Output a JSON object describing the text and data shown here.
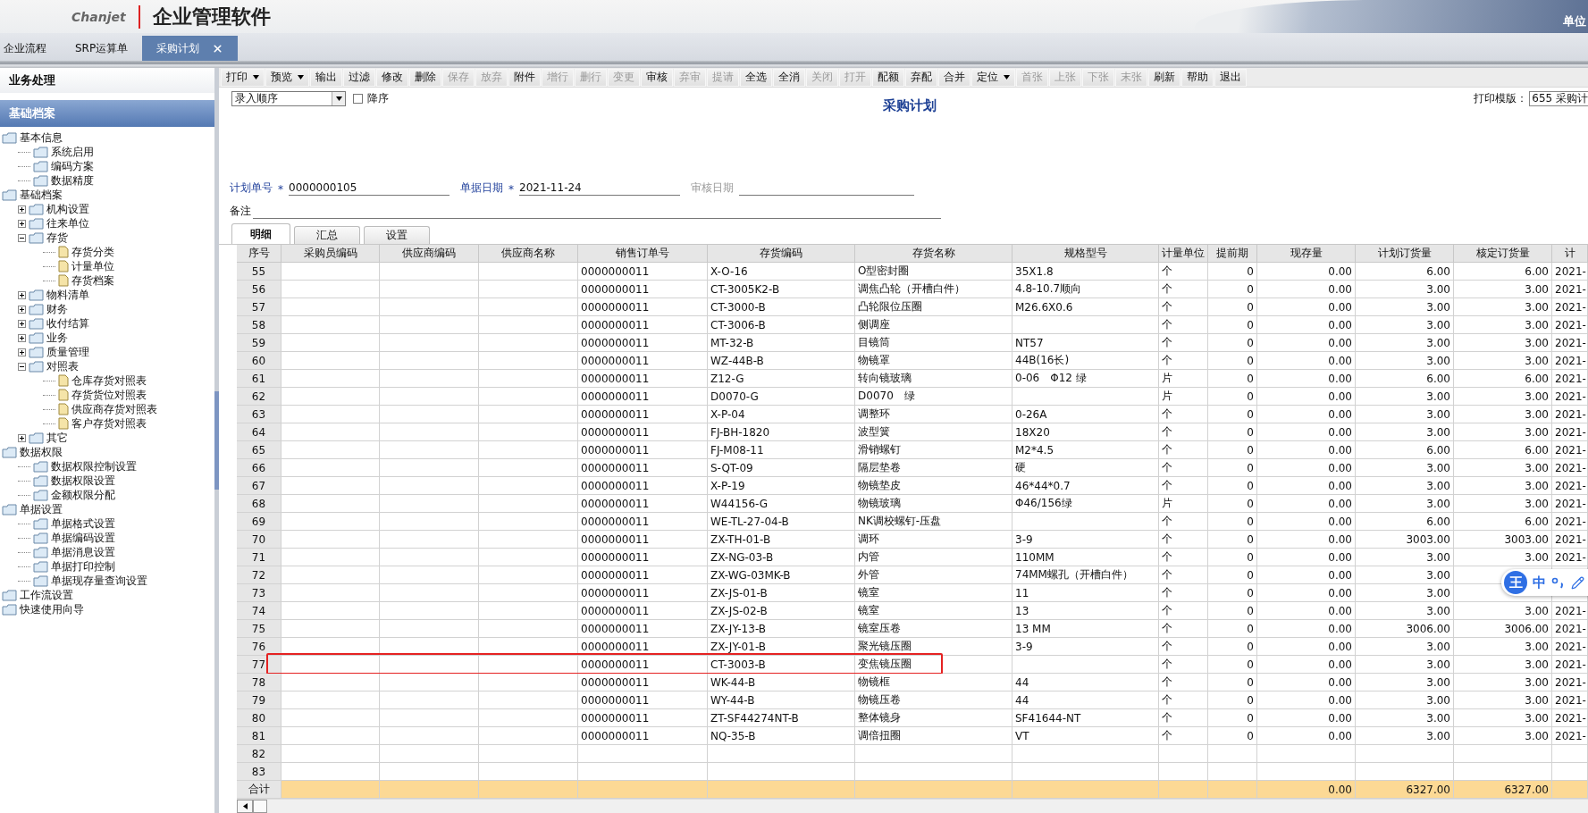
{
  "header": {
    "brand": "Chanjet",
    "product": "企业管理软件",
    "user_label": "单位"
  },
  "doc_tabs": [
    {
      "label": "企业流程",
      "selected": false,
      "closable": false
    },
    {
      "label": "SRP运算单",
      "selected": false,
      "closable": false
    },
    {
      "label": "采购计划",
      "selected": true,
      "closable": true
    }
  ],
  "sidebar": {
    "sections": [
      {
        "label": "业务处理",
        "selected": false
      },
      {
        "label": "基础档案",
        "selected": true
      }
    ],
    "tree": [
      {
        "label": "基本信息",
        "kind": "folder",
        "children": [
          {
            "label": "系统启用",
            "kind": "folder"
          },
          {
            "label": "编码方案",
            "kind": "folder"
          },
          {
            "label": "数据精度",
            "kind": "folder"
          }
        ]
      },
      {
        "label": "基础档案",
        "kind": "folder",
        "children": [
          {
            "label": "机构设置",
            "kind": "folder",
            "expanded": false
          },
          {
            "label": "往来单位",
            "kind": "folder",
            "expanded": false
          },
          {
            "label": "存货",
            "kind": "folder",
            "expanded": true,
            "children": [
              {
                "label": "存货分类",
                "kind": "document"
              },
              {
                "label": "计量单位",
                "kind": "document"
              },
              {
                "label": "存货档案",
                "kind": "document"
              }
            ]
          },
          {
            "label": "物料清单",
            "kind": "folder",
            "expanded": false
          },
          {
            "label": "财务",
            "kind": "folder",
            "expanded": false
          },
          {
            "label": "收付结算",
            "kind": "folder",
            "expanded": false
          },
          {
            "label": "业务",
            "kind": "folder",
            "expanded": false
          },
          {
            "label": "质量管理",
            "kind": "folder",
            "expanded": false
          },
          {
            "label": "对照表",
            "kind": "folder",
            "expanded": true,
            "children": [
              {
                "label": "仓库存货对照表",
                "kind": "document"
              },
              {
                "label": "存货货位对照表",
                "kind": "document"
              },
              {
                "label": "供应商存货对照表",
                "kind": "document"
              },
              {
                "label": "客户存货对照表",
                "kind": "document"
              }
            ]
          },
          {
            "label": "其它",
            "kind": "folder",
            "expanded": false
          }
        ]
      },
      {
        "label": "数据权限",
        "kind": "folder",
        "children": [
          {
            "label": "数据权限控制设置",
            "kind": "folder"
          },
          {
            "label": "数据权限设置",
            "kind": "folder"
          },
          {
            "label": "金额权限分配",
            "kind": "folder"
          }
        ]
      },
      {
        "label": "单据设置",
        "kind": "folder",
        "children": [
          {
            "label": "单据格式设置",
            "kind": "folder"
          },
          {
            "label": "单据编码设置",
            "kind": "folder"
          },
          {
            "label": "单据消息设置",
            "kind": "folder"
          },
          {
            "label": "单据打印控制",
            "kind": "folder"
          },
          {
            "label": "单据现存量查询设置",
            "kind": "folder"
          }
        ]
      },
      {
        "label": "工作流设置",
        "kind": "folder"
      },
      {
        "label": "快速使用向导",
        "kind": "folder"
      }
    ]
  },
  "toolbar": [
    {
      "label": "打印",
      "dropdown": true,
      "disabled": false
    },
    {
      "label": "预览",
      "dropdown": true,
      "disabled": false
    },
    {
      "label": "输出",
      "dropdown": false,
      "disabled": false
    },
    {
      "label": "过滤",
      "dropdown": false,
      "disabled": false
    },
    {
      "label": "修改",
      "dropdown": false,
      "disabled": false
    },
    {
      "label": "删除",
      "dropdown": false,
      "disabled": false
    },
    {
      "label": "保存",
      "dropdown": false,
      "disabled": true
    },
    {
      "label": "放弃",
      "dropdown": false,
      "disabled": true
    },
    {
      "label": "附件",
      "dropdown": false,
      "disabled": false
    },
    {
      "label": "增行",
      "dropdown": false,
      "disabled": true
    },
    {
      "label": "删行",
      "dropdown": false,
      "disabled": true
    },
    {
      "label": "变更",
      "dropdown": false,
      "disabled": true
    },
    {
      "label": "审核",
      "dropdown": false,
      "disabled": false
    },
    {
      "label": "弃审",
      "dropdown": false,
      "disabled": true
    },
    {
      "label": "提请",
      "dropdown": false,
      "disabled": true
    },
    {
      "label": "全选",
      "dropdown": false,
      "disabled": false
    },
    {
      "label": "全消",
      "dropdown": false,
      "disabled": false
    },
    {
      "label": "关闭",
      "dropdown": false,
      "disabled": true
    },
    {
      "label": "打开",
      "dropdown": false,
      "disabled": true
    },
    {
      "label": "配额",
      "dropdown": false,
      "disabled": false
    },
    {
      "label": "弃配",
      "dropdown": false,
      "disabled": false
    },
    {
      "label": "合并",
      "dropdown": false,
      "disabled": false
    },
    {
      "label": "定位",
      "dropdown": true,
      "disabled": false
    },
    {
      "label": "首张",
      "dropdown": false,
      "disabled": true
    },
    {
      "label": "上张",
      "dropdown": false,
      "disabled": true
    },
    {
      "label": "下张",
      "dropdown": false,
      "disabled": true
    },
    {
      "label": "末张",
      "dropdown": false,
      "disabled": true
    },
    {
      "label": "刷新",
      "dropdown": false,
      "disabled": false
    },
    {
      "label": "帮助",
      "dropdown": false,
      "disabled": false
    },
    {
      "label": "退出",
      "dropdown": false,
      "disabled": false
    }
  ],
  "form": {
    "sort": {
      "value": "录入顺序"
    },
    "descending": {
      "label": "降序",
      "checked": false
    },
    "title": "采购计划",
    "print_template": {
      "label": "打印模版：",
      "value": "655 采购计"
    },
    "fields": [
      {
        "label": "计划单号",
        "required_mark": "*",
        "value": "0000000105",
        "disabled": false
      },
      {
        "label": "单据日期",
        "required_mark": "*",
        "value": "2021-11-24",
        "disabled": false
      },
      {
        "label": "审核日期",
        "disabled": true
      }
    ],
    "note": {
      "label": "备注"
    }
  },
  "detail_tabs": [
    {
      "label": "明细",
      "selected": true
    },
    {
      "label": "汇总",
      "selected": false
    },
    {
      "label": "设置",
      "selected": false
    }
  ],
  "table": {
    "columns": [
      "序号",
      "采购员编码",
      "供应商编码",
      "供应商名称",
      "销售订单号",
      "存货编码",
      "存货名称",
      "规格型号",
      "计量单位",
      "提前期",
      "现存量",
      "计划订货量",
      "核定订货量",
      "计"
    ],
    "rows": [
      {
        "highlighted": false,
        "no": "55",
        "sales_order": "0000000011",
        "item_code": "X-O-16",
        "item_name": "O型密封圈",
        "spec": "35X1.8",
        "unit": "个",
        "lead_time": "0",
        "on_hand": "0.00",
        "planned_qty": "6.00",
        "approved_qty": "6.00",
        "column_14": "2021-"
      },
      {
        "highlighted": false,
        "no": "56",
        "sales_order": "0000000011",
        "item_code": "CT-3005K2-B",
        "item_name": "调焦凸轮（开槽白件）",
        "spec": "4.8-10.7顺向",
        "unit": "个",
        "lead_time": "0",
        "on_hand": "0.00",
        "planned_qty": "3.00",
        "approved_qty": "3.00",
        "column_14": "2021-"
      },
      {
        "highlighted": false,
        "no": "57",
        "sales_order": "0000000011",
        "item_code": "CT-3000-B",
        "item_name": "凸轮限位压圈",
        "spec": "M26.6X0.6",
        "unit": "个",
        "lead_time": "0",
        "on_hand": "0.00",
        "planned_qty": "3.00",
        "approved_qty": "3.00",
        "column_14": "2021-"
      },
      {
        "highlighted": false,
        "no": "58",
        "sales_order": "0000000011",
        "item_code": "CT-3006-B",
        "item_name": "侧调座",
        "unit": "个",
        "lead_time": "0",
        "on_hand": "0.00",
        "planned_qty": "3.00",
        "approved_qty": "3.00",
        "column_14": "2021-"
      },
      {
        "highlighted": false,
        "no": "59",
        "sales_order": "0000000011",
        "item_code": "MT-32-B",
        "item_name": "目镜筒",
        "spec": "NT57",
        "unit": "个",
        "lead_time": "0",
        "on_hand": "0.00",
        "planned_qty": "3.00",
        "approved_qty": "3.00",
        "column_14": "2021-"
      },
      {
        "highlighted": false,
        "no": "60",
        "sales_order": "0000000011",
        "item_code": "WZ-44B-B",
        "item_name": "物镜罩",
        "spec": "44B(16长)",
        "unit": "个",
        "lead_time": "0",
        "on_hand": "0.00",
        "planned_qty": "3.00",
        "approved_qty": "3.00",
        "column_14": "2021-"
      },
      {
        "highlighted": false,
        "no": "61",
        "sales_order": "0000000011",
        "item_code": "Z12-G",
        "item_name": "转向镜玻璃",
        "spec": "0-06　Φ12 绿",
        "unit": "片",
        "lead_time": "0",
        "on_hand": "0.00",
        "planned_qty": "6.00",
        "approved_qty": "6.00",
        "column_14": "2021-"
      },
      {
        "highlighted": false,
        "no": "62",
        "sales_order": "0000000011",
        "item_code": "D0070-G",
        "item_name": "D0070　绿",
        "unit": "片",
        "lead_time": "0",
        "on_hand": "0.00",
        "planned_qty": "3.00",
        "approved_qty": "3.00",
        "column_14": "2021-"
      },
      {
        "highlighted": false,
        "no": "63",
        "sales_order": "0000000011",
        "item_code": "X-P-04",
        "item_name": "调整环",
        "spec": "0-26A",
        "unit": "个",
        "lead_time": "0",
        "on_hand": "0.00",
        "planned_qty": "3.00",
        "approved_qty": "3.00",
        "column_14": "2021-"
      },
      {
        "highlighted": false,
        "no": "64",
        "sales_order": "0000000011",
        "item_code": "FJ-BH-1820",
        "item_name": "波型簧",
        "spec": "18X20",
        "unit": "个",
        "lead_time": "0",
        "on_hand": "0.00",
        "planned_qty": "3.00",
        "approved_qty": "3.00",
        "column_14": "2021-"
      },
      {
        "highlighted": false,
        "no": "65",
        "sales_order": "0000000011",
        "item_code": "FJ-M08-11",
        "item_name": "滑销螺钉",
        "spec": "M2*4.5",
        "unit": "个",
        "lead_time": "0",
        "on_hand": "0.00",
        "planned_qty": "6.00",
        "approved_qty": "6.00",
        "column_14": "2021-"
      },
      {
        "highlighted": false,
        "no": "66",
        "sales_order": "0000000011",
        "item_code": "S-QT-09",
        "item_name": "隔层垫卷",
        "spec": "硬",
        "unit": "个",
        "lead_time": "0",
        "on_hand": "0.00",
        "planned_qty": "3.00",
        "approved_qty": "3.00",
        "column_14": "2021-"
      },
      {
        "highlighted": false,
        "no": "67",
        "sales_order": "0000000011",
        "item_code": "X-P-19",
        "item_name": "物镜垫皮",
        "spec": "46*44*0.7",
        "unit": "个",
        "lead_time": "0",
        "on_hand": "0.00",
        "planned_qty": "3.00",
        "approved_qty": "3.00",
        "column_14": "2021-"
      },
      {
        "highlighted": false,
        "no": "68",
        "sales_order": "0000000011",
        "item_code": "W44156-G",
        "item_name": "物镜玻璃",
        "spec": "Φ46/156绿",
        "unit": "片",
        "lead_time": "0",
        "on_hand": "0.00",
        "planned_qty": "3.00",
        "approved_qty": "3.00",
        "column_14": "2021-"
      },
      {
        "highlighted": false,
        "no": "69",
        "sales_order": "0000000011",
        "item_code": "WE-TL-27-04-B",
        "item_name": "NK调校螺钉-压盘",
        "unit": "个",
        "lead_time": "0",
        "on_hand": "0.00",
        "planned_qty": "6.00",
        "approved_qty": "6.00",
        "column_14": "2021-"
      },
      {
        "highlighted": false,
        "no": "70",
        "sales_order": "0000000011",
        "item_code": "ZX-TH-01-B",
        "item_name": "调环",
        "spec": "3-9",
        "unit": "个",
        "lead_time": "0",
        "on_hand": "0.00",
        "planned_qty": "3003.00",
        "approved_qty": "3003.00",
        "column_14": "2021-"
      },
      {
        "highlighted": false,
        "no": "71",
        "sales_order": "0000000011",
        "item_code": "ZX-NG-03-B",
        "item_name": "内管",
        "spec": "110MM",
        "unit": "个",
        "lead_time": "0",
        "on_hand": "0.00",
        "planned_qty": "3.00",
        "approved_qty": "3.00",
        "column_14": "2021-"
      },
      {
        "highlighted": false,
        "no": "72",
        "sales_order": "0000000011",
        "item_code": "ZX-WG-03MK-B",
        "item_name": "外管",
        "spec": "74MM螺孔（开槽白件）",
        "unit": "个",
        "lead_time": "0",
        "on_hand": "0.00",
        "planned_qty": "3.00"
      },
      {
        "highlighted": false,
        "no": "73",
        "sales_order": "0000000011",
        "item_code": "ZX-JS-01-B",
        "item_name": "镜室",
        "spec": "11",
        "unit": "个",
        "lead_time": "0",
        "on_hand": "0.00",
        "planned_qty": "3.00"
      },
      {
        "highlighted": false,
        "no": "74",
        "sales_order": "0000000011",
        "item_code": "ZX-JS-02-B",
        "item_name": "镜室",
        "spec": "13",
        "unit": "个",
        "lead_time": "0",
        "on_hand": "0.00",
        "planned_qty": "3.00",
        "approved_qty": "3.00",
        "column_14": "2021-"
      },
      {
        "highlighted": false,
        "no": "75",
        "sales_order": "0000000011",
        "item_code": "ZX-JY-13-B",
        "item_name": "镜室压卷",
        "spec": "13 MM",
        "unit": "个",
        "lead_time": "0",
        "on_hand": "0.00",
        "planned_qty": "3006.00",
        "approved_qty": "3006.00",
        "column_14": "2021-"
      },
      {
        "highlighted": false,
        "no": "76",
        "sales_order": "0000000011",
        "item_code": "ZX-JY-01-B",
        "item_name": "聚光镜压圈",
        "spec": "3-9",
        "unit": "个",
        "lead_time": "0",
        "on_hand": "0.00",
        "planned_qty": "3.00",
        "approved_qty": "3.00",
        "column_14": "2021-"
      },
      {
        "highlighted": true,
        "no": "77",
        "sales_order": "0000000011",
        "item_code": "CT-3003-B",
        "item_name": "变焦镜压圈",
        "unit": "个",
        "lead_time": "0",
        "on_hand": "0.00",
        "planned_qty": "3.00",
        "approved_qty": "3.00",
        "column_14": "2021-"
      },
      {
        "highlighted": false,
        "no": "78",
        "sales_order": "0000000011",
        "item_code": "WK-44-B",
        "item_name": "物镜框",
        "spec": "44",
        "unit": "个",
        "lead_time": "0",
        "on_hand": "0.00",
        "planned_qty": "3.00",
        "approved_qty": "3.00",
        "column_14": "2021-"
      },
      {
        "highlighted": false,
        "no": "79",
        "sales_order": "0000000011",
        "item_code": "WY-44-B",
        "item_name": "物镜压卷",
        "spec": "44",
        "unit": "个",
        "lead_time": "0",
        "on_hand": "0.00",
        "planned_qty": "3.00",
        "approved_qty": "3.00",
        "column_14": "2021-"
      },
      {
        "highlighted": false,
        "no": "80",
        "sales_order": "0000000011",
        "item_code": "ZT-SF44274NT-B",
        "item_name": "整体镜身",
        "spec": "SF41644-NT",
        "unit": "个",
        "lead_time": "0",
        "on_hand": "0.00",
        "planned_qty": "3.00",
        "approved_qty": "3.00",
        "column_14": "2021-"
      },
      {
        "highlighted": false,
        "no": "81",
        "sales_order": "0000000011",
        "item_code": "NQ-35-B",
        "item_name": "调倍扭圈",
        "spec": "VT",
        "unit": "个",
        "lead_time": "0",
        "on_hand": "0.00",
        "planned_qty": "3.00",
        "approved_qty": "3.00",
        "column_14": "2021-"
      },
      {
        "highlighted": false,
        "no": "82"
      },
      {
        "highlighted": false,
        "no": "83"
      }
    ],
    "total": {
      "no": "合计",
      "on_hand": "0.00",
      "planned_qty": "6327.00",
      "approved_qty": "6327.00"
    }
  },
  "ime": {
    "logo": "王",
    "mode": "中"
  }
}
